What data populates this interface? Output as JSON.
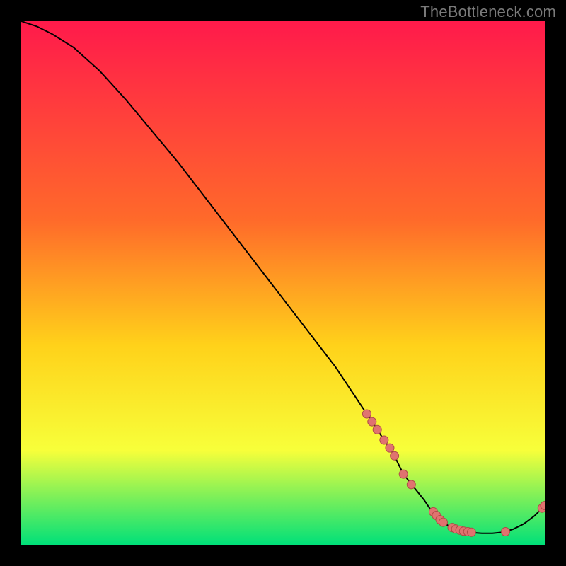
{
  "watermark": "TheBottleneck.com",
  "colors": {
    "page_bg": "#000000",
    "gradient_top": "#ff1a4b",
    "gradient_mid1": "#ff6a2a",
    "gradient_mid2": "#ffd21a",
    "gradient_mid3": "#f7ff3a",
    "gradient_bottom": "#00e079",
    "curve": "#000000",
    "marker_fill": "#e0736f",
    "marker_stroke": "#af4b47"
  },
  "chart_data": {
    "type": "line",
    "title": "",
    "xlabel": "",
    "ylabel": "",
    "xlim": [
      0,
      100
    ],
    "ylim": [
      0,
      100
    ],
    "legend": false,
    "grid": false,
    "notes": "Bottleneck curve: monotone descent to a flat minimum then slight rise at the far right. Gradient background red→green top→bottom. Salmon markers highlight the steep segment and the flat minimum.",
    "series": [
      {
        "name": "curve",
        "x": [
          0,
          3,
          6,
          10,
          15,
          20,
          25,
          30,
          35,
          40,
          45,
          50,
          55,
          60,
          64,
          66,
          68,
          69.3,
          70.4,
          71.3,
          72,
          73,
          75,
          77,
          78,
          79,
          80,
          81,
          82,
          83,
          85,
          86.5,
          88,
          90,
          92,
          94,
          96,
          98,
          100
        ],
        "y": [
          100,
          99,
          97.5,
          95,
          90.5,
          85,
          79,
          73,
          66.5,
          60,
          53.5,
          47,
          40.5,
          34,
          28,
          25,
          22,
          20,
          18.5,
          17,
          15.5,
          13.5,
          11,
          8.5,
          7.0,
          5.8,
          4.8,
          4.0,
          3.4,
          3.0,
          2.5,
          2.3,
          2.2,
          2.2,
          2.4,
          3.0,
          4.0,
          5.5,
          7.5
        ]
      }
    ],
    "markers": [
      {
        "x": 66.0,
        "y": 25.0
      },
      {
        "x": 67.0,
        "y": 23.5
      },
      {
        "x": 68.0,
        "y": 22.0
      },
      {
        "x": 69.3,
        "y": 20.0
      },
      {
        "x": 70.4,
        "y": 18.5
      },
      {
        "x": 71.3,
        "y": 17.0
      },
      {
        "x": 73.0,
        "y": 13.5
      },
      {
        "x": 74.5,
        "y": 11.5
      },
      {
        "x": 78.7,
        "y": 6.3
      },
      {
        "x": 79.3,
        "y": 5.6
      },
      {
        "x": 80.0,
        "y": 4.8
      },
      {
        "x": 80.6,
        "y": 4.3
      },
      {
        "x": 82.3,
        "y": 3.3
      },
      {
        "x": 83.0,
        "y": 3.0
      },
      {
        "x": 83.8,
        "y": 2.8
      },
      {
        "x": 84.5,
        "y": 2.6
      },
      {
        "x": 85.3,
        "y": 2.5
      },
      {
        "x": 86.0,
        "y": 2.4
      },
      {
        "x": 92.5,
        "y": 2.5
      },
      {
        "x": 99.5,
        "y": 7.0
      },
      {
        "x": 100.0,
        "y": 7.5
      }
    ]
  }
}
